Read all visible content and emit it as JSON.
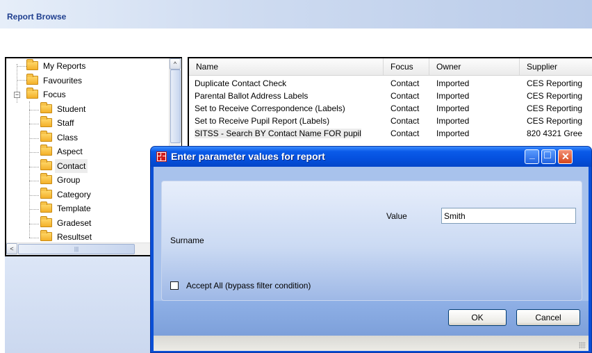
{
  "header": {
    "title": "Report Browse"
  },
  "tree": {
    "items": [
      {
        "label": "My Reports",
        "level": 0
      },
      {
        "label": "Favourites",
        "level": 0
      },
      {
        "label": "Focus",
        "level": 0,
        "expanded": true,
        "expander": "−"
      },
      {
        "label": "Student",
        "level": 1
      },
      {
        "label": "Staff",
        "level": 1
      },
      {
        "label": "Class",
        "level": 1
      },
      {
        "label": "Aspect",
        "level": 1
      },
      {
        "label": "Contact",
        "level": 1,
        "selected": true
      },
      {
        "label": "Group",
        "level": 1
      },
      {
        "label": "Category",
        "level": 1
      },
      {
        "label": "Template",
        "level": 1
      },
      {
        "label": "Gradeset",
        "level": 1
      },
      {
        "label": "Resultset",
        "level": 1
      }
    ],
    "scroll_up": "^",
    "scroll_left": "<",
    "hthumb_grip": "|||"
  },
  "list": {
    "columns": [
      "Name",
      "Focus",
      "Owner",
      "Supplier"
    ],
    "rows": [
      {
        "name": "Duplicate Contact Check",
        "focus": "Contact",
        "owner": "Imported",
        "supplier": "CES Reporting"
      },
      {
        "name": "Parental Ballot Address Labels",
        "focus": "Contact",
        "owner": "Imported",
        "supplier": "CES Reporting"
      },
      {
        "name": "Set to Receive Correspondence (Labels)",
        "focus": "Contact",
        "owner": "Imported",
        "supplier": "CES Reporting"
      },
      {
        "name": "Set to Receive Pupil Report (Labels)",
        "focus": "Contact",
        "owner": "Imported",
        "supplier": "CES Reporting"
      },
      {
        "name": "SITSS - Search BY Contact Name FOR pupil",
        "focus": "Contact",
        "owner": "Imported",
        "supplier": "820 4321 Gree",
        "selected": true
      }
    ]
  },
  "dialog": {
    "title": "Enter parameter values for report",
    "value_label": "Value",
    "value_input": "Smith",
    "param_label": "Surname",
    "accept_all_label": "Accept All (bypass filter condition)",
    "accept_all_checked": false,
    "ok_label": "OK",
    "cancel_label": "Cancel",
    "minimize_glyph": "_",
    "maximize_glyph": "□",
    "close_glyph": "✕"
  },
  "colors": {
    "title_text": "#1f3f8f",
    "dialog_titlebar": "#0550de",
    "dialog_body": "#a8c2ec",
    "close_button": "#d6461b"
  }
}
